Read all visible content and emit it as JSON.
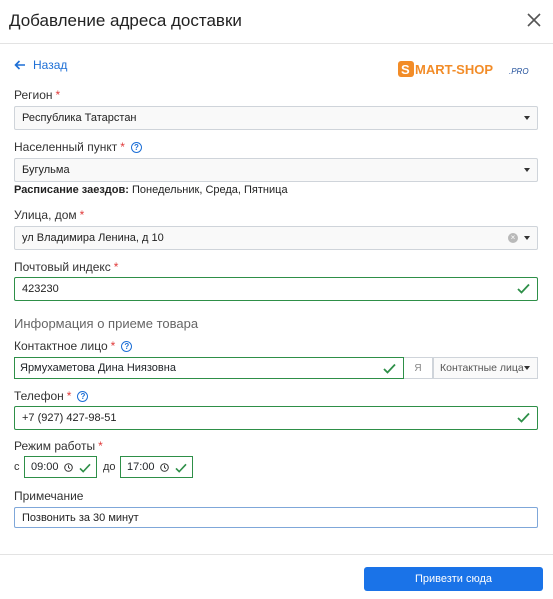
{
  "dialog": {
    "title": "Добавление адреса доставки",
    "back_label": "Назад",
    "logo": {
      "prefix": "S",
      "main": "MART-SHOP",
      "suffix": ".PRO",
      "orange": "#f28c28",
      "blue": "#1f4e9a"
    }
  },
  "fields": {
    "region": {
      "label": "Регион",
      "value": "Республика Татарстан"
    },
    "city": {
      "label": "Населенный пункт",
      "value": "Бугульма"
    },
    "schedule": {
      "label": "Расписание заездов:",
      "value": "Понедельник, Среда, Пятница"
    },
    "street": {
      "label": "Улица, дом",
      "value": "ул Владимира Ленина, д 10"
    },
    "postal": {
      "label": "Почтовый индекс",
      "value": "423230"
    }
  },
  "receiving": {
    "section_title": "Информация о приеме товара",
    "contact": {
      "label": "Контактное лицо",
      "value": "Ярмухаметова Дина Ниязовна",
      "me_label": "Я",
      "dropdown": "Контактные лица"
    },
    "phone": {
      "label": "Телефон",
      "value": "+7 (927) 427-98-51"
    },
    "hours": {
      "label": "Режим работы",
      "from_prefix": "с",
      "from": "09:00",
      "to_prefix": "до",
      "to": "17:00"
    },
    "note": {
      "label": "Примечание",
      "value": "Позвонить за 30 минут"
    }
  },
  "footer": {
    "submit_label": "Привезти сюда"
  },
  "colors": {
    "accent": "#1a73e8",
    "valid": "#2e8f48",
    "required": "#e03a3a"
  }
}
